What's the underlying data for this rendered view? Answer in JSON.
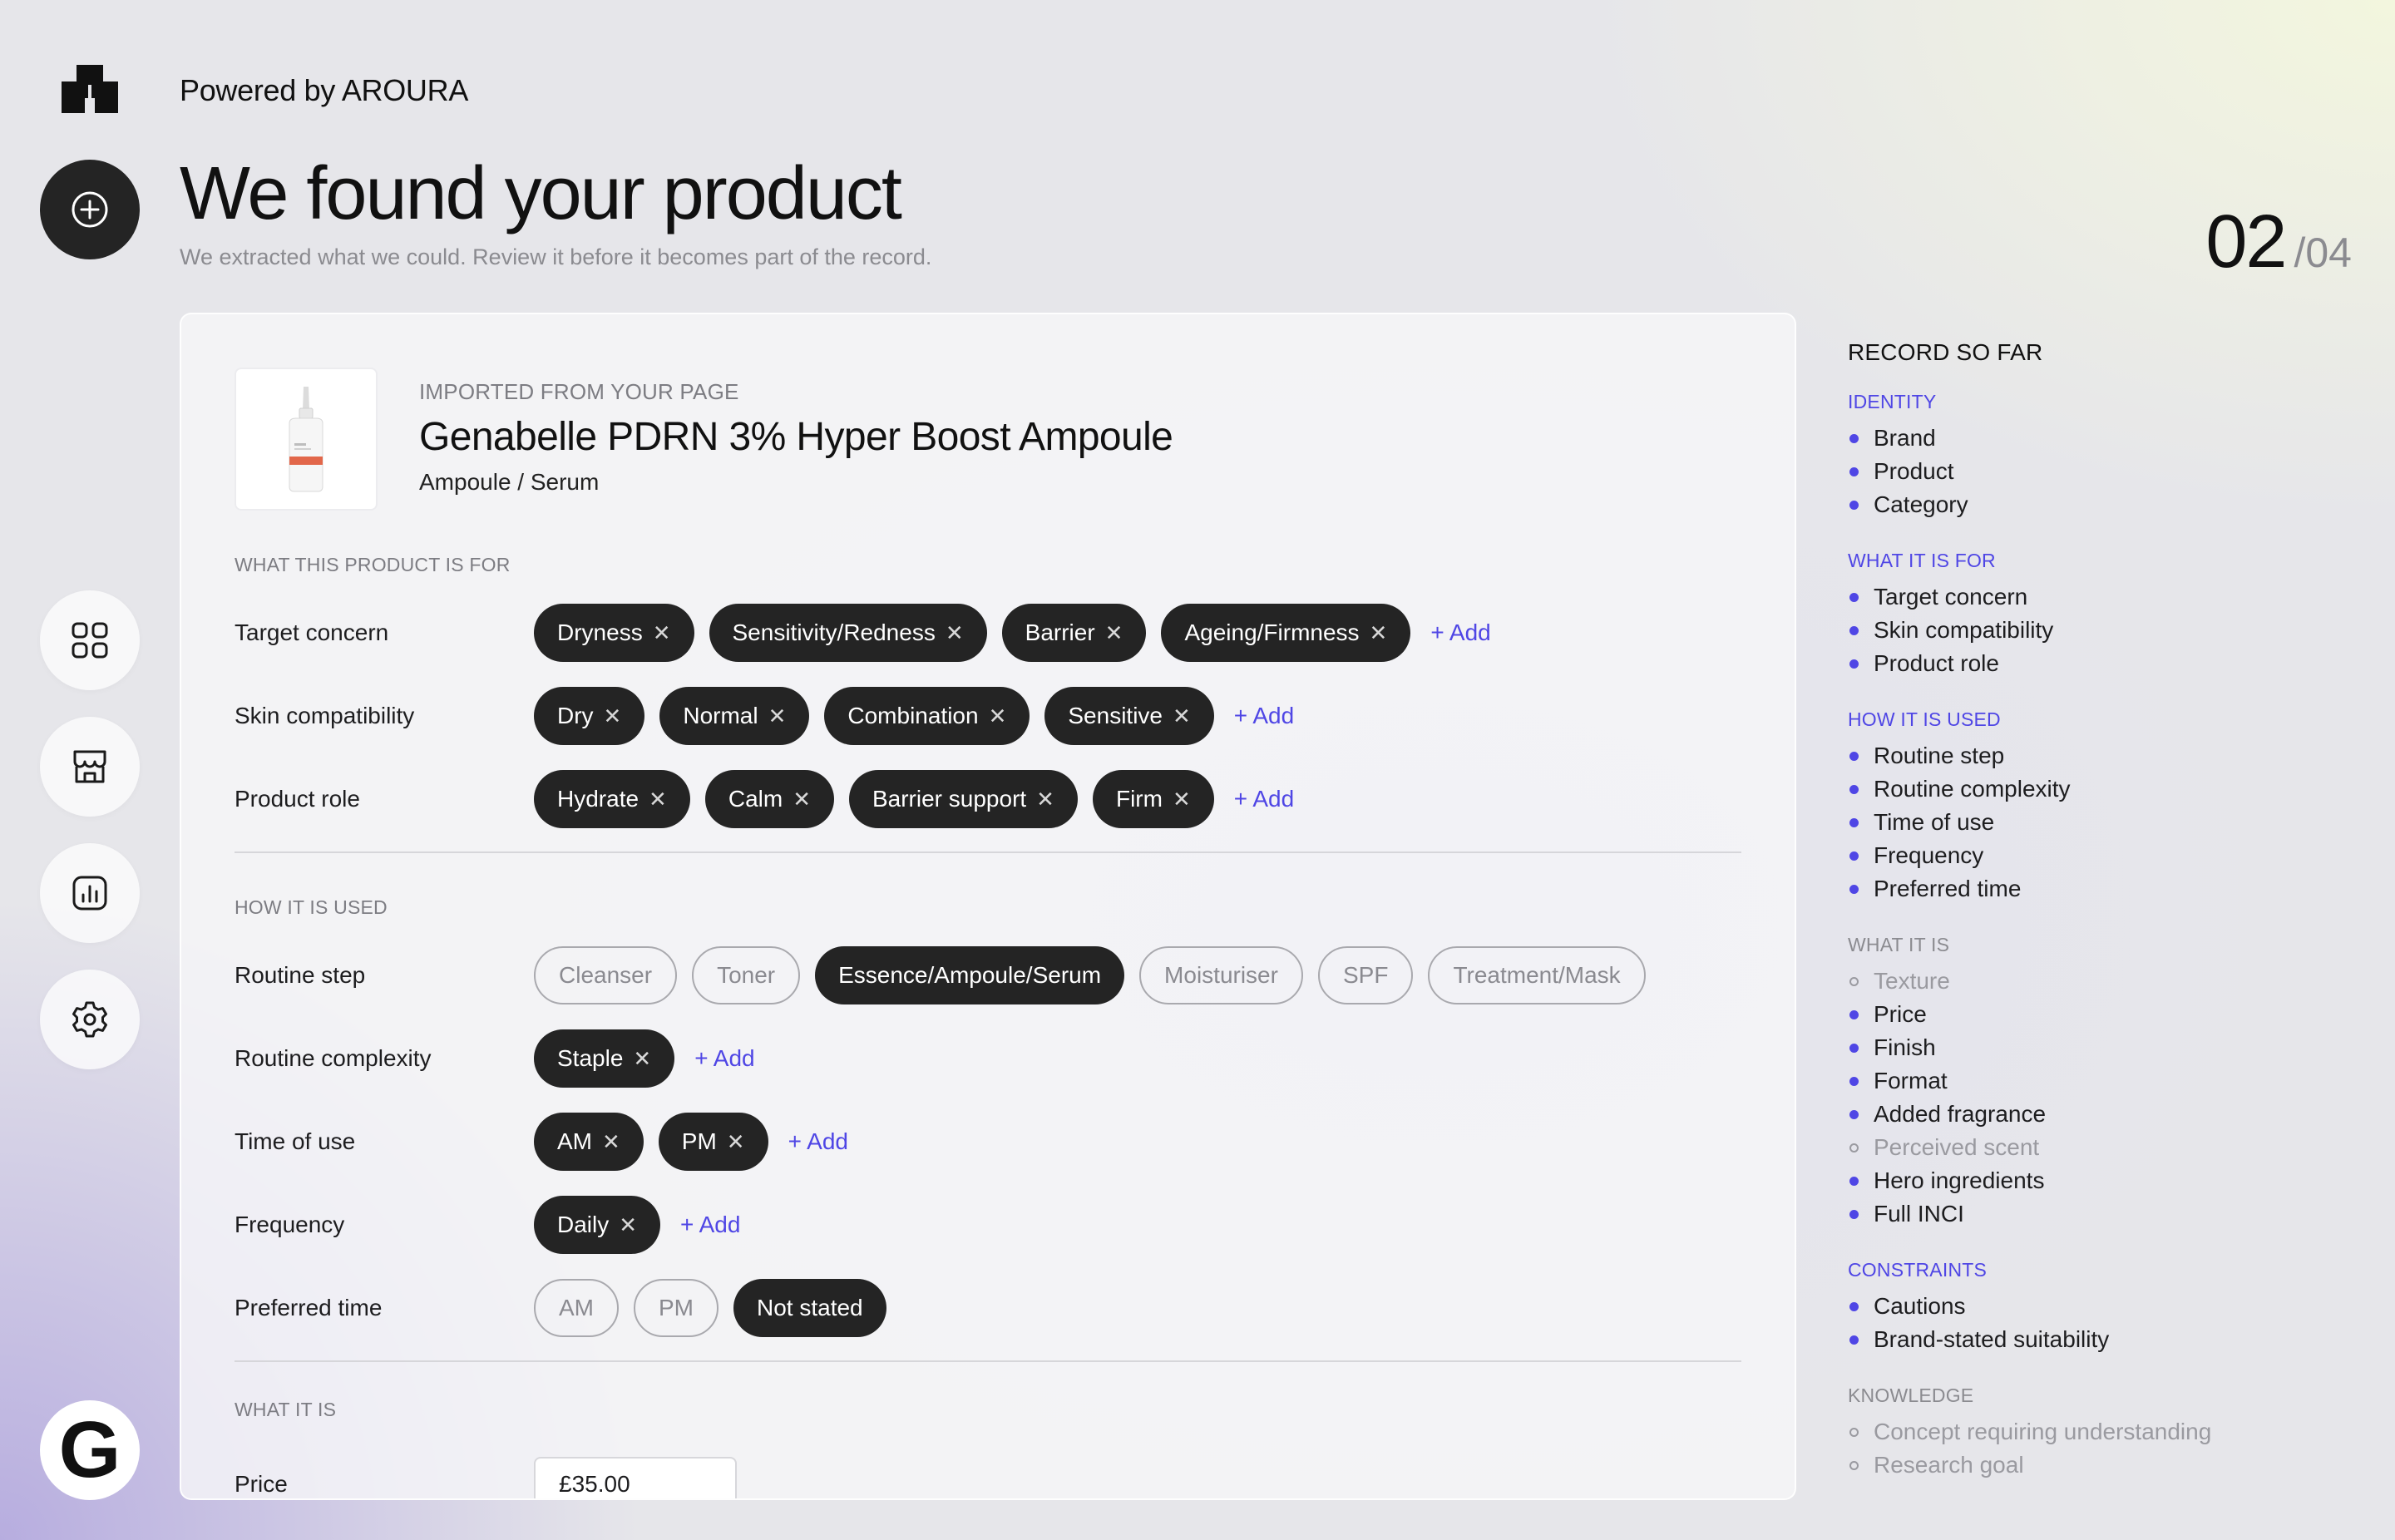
{
  "header": {
    "powered_by": "Powered by AROURA",
    "title": "We found your product",
    "subtitle": "We extracted what we could. Review it before it becomes part of the record.",
    "step_current": "02",
    "step_total": "/04"
  },
  "nav": {
    "items": [
      "grid-icon",
      "storefront-icon",
      "bar-chart-icon",
      "gear-icon"
    ],
    "brand_letter": "G"
  },
  "product": {
    "imported_label": "IMPORTED FROM YOUR PAGE",
    "name": "Genabelle PDRN 3% Hyper Boost Ampoule",
    "category": "Ampoule / Serum"
  },
  "sections": {
    "for": {
      "label": "WHAT THIS PRODUCT IS FOR",
      "rows": [
        {
          "label": "Target concern",
          "chips": [
            "Dryness",
            "Sensitivity/Redness",
            "Barrier",
            "Ageing/Firmness"
          ],
          "add": "+ Add"
        },
        {
          "label": "Skin compatibility",
          "chips": [
            "Dry",
            "Normal",
            "Combination",
            "Sensitive"
          ],
          "add": "+ Add"
        },
        {
          "label": "Product role",
          "chips": [
            "Hydrate",
            "Calm",
            "Barrier support",
            "Firm"
          ],
          "add": "+ Add"
        }
      ]
    },
    "used": {
      "label": "HOW IT IS USED",
      "routine_step": {
        "label": "Routine step",
        "options": [
          "Cleanser",
          "Toner",
          "Essence/Ampoule/Serum",
          "Moisturiser",
          "SPF",
          "Treatment/Mask"
        ],
        "selected": "Essence/Ampoule/Serum"
      },
      "rows": [
        {
          "label": "Routine complexity",
          "chips": [
            "Staple"
          ],
          "add": "+ Add"
        },
        {
          "label": "Time of use",
          "chips": [
            "AM",
            "PM"
          ],
          "add": "+ Add"
        },
        {
          "label": "Frequency",
          "chips": [
            "Daily"
          ],
          "add": "+ Add"
        }
      ],
      "preferred_time": {
        "label": "Preferred time",
        "options": [
          "AM",
          "PM",
          "Not stated"
        ],
        "selected": "Not stated"
      }
    },
    "is": {
      "label": "WHAT IT IS",
      "price": {
        "label": "Price",
        "value": "£35.00"
      }
    }
  },
  "record": {
    "title": "RECORD SO FAR",
    "groups": [
      {
        "title": "IDENTITY",
        "active": true,
        "items": [
          {
            "label": "Brand",
            "done": true
          },
          {
            "label": "Product",
            "done": true
          },
          {
            "label": "Category",
            "done": true
          }
        ]
      },
      {
        "title": "WHAT IT IS FOR",
        "active": true,
        "items": [
          {
            "label": "Target concern",
            "done": true
          },
          {
            "label": "Skin compatibility",
            "done": true
          },
          {
            "label": "Product role",
            "done": true
          }
        ]
      },
      {
        "title": "HOW IT IS USED",
        "active": true,
        "items": [
          {
            "label": "Routine step",
            "done": true
          },
          {
            "label": "Routine complexity",
            "done": true
          },
          {
            "label": "Time of use",
            "done": true
          },
          {
            "label": "Frequency",
            "done": true
          },
          {
            "label": "Preferred time",
            "done": true
          }
        ]
      },
      {
        "title": "WHAT IT IS",
        "active": false,
        "items": [
          {
            "label": "Texture",
            "done": false
          },
          {
            "label": "Price",
            "done": true
          },
          {
            "label": "Finish",
            "done": true
          },
          {
            "label": "Format",
            "done": true
          },
          {
            "label": "Added fragrance",
            "done": true
          },
          {
            "label": "Perceived scent",
            "done": false
          },
          {
            "label": "Hero ingredients",
            "done": true
          },
          {
            "label": "Full INCI",
            "done": true
          }
        ]
      },
      {
        "title": "CONSTRAINTS",
        "active": true,
        "items": [
          {
            "label": "Cautions",
            "done": true
          },
          {
            "label": "Brand-stated suitability",
            "done": true
          }
        ]
      },
      {
        "title": "KNOWLEDGE",
        "active": false,
        "items": [
          {
            "label": "Concept requiring understanding",
            "done": false
          },
          {
            "label": "Research goal",
            "done": false
          }
        ]
      }
    ]
  },
  "colors": {
    "accent": "#4f46e5",
    "chip_dark": "#242424"
  }
}
